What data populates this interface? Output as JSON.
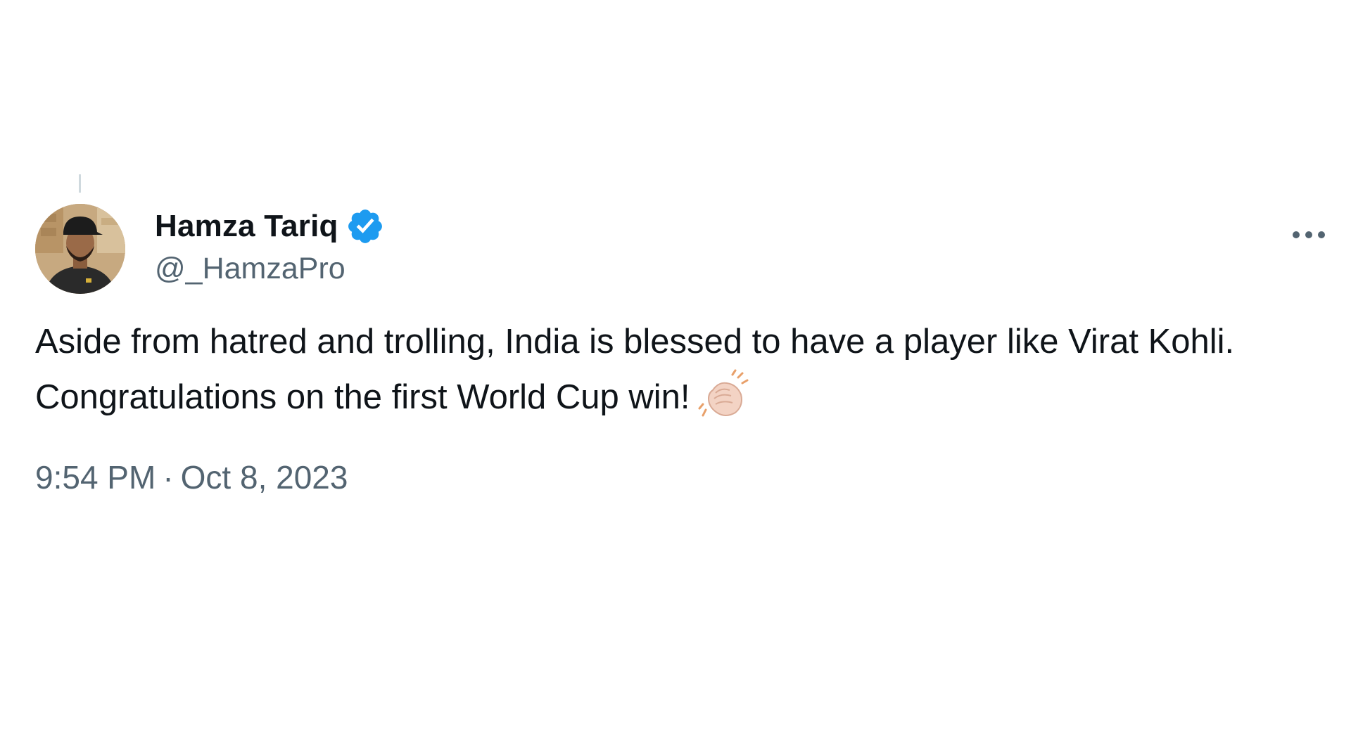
{
  "tweet": {
    "author": {
      "display_name": "Hamza Tariq",
      "handle": "@_HamzaPro",
      "verified": true,
      "avatar": "profile-photo"
    },
    "text": "Aside from hatred and trolling, India is blessed to have a player like Virat Kohli. Congratulations on the first World Cup win!",
    "emoji": "clapping-hands-icon",
    "time": "9:54 PM",
    "separator": "·",
    "date": "Oct 8, 2023"
  },
  "icons": {
    "verified_badge": "verified-badge-icon",
    "more": "more-options-icon"
  },
  "colors": {
    "text_primary": "#0f1419",
    "text_secondary": "#536471",
    "verified_blue": "#1d9bf0",
    "thread_line": "#cfd9de",
    "background": "#ffffff"
  }
}
